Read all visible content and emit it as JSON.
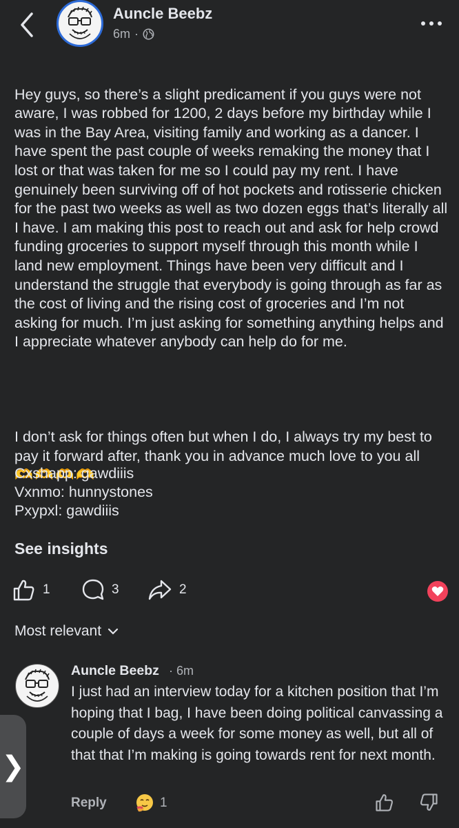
{
  "header": {
    "author": "Auncle Beebz",
    "time": "6m",
    "separator": "·",
    "privacy_icon": "globe-icon",
    "more_icon": "more-horizontal-icon",
    "back_icon": "chevron-left-icon"
  },
  "post": {
    "paragraph1": "Hey guys, so there’s a slight predicament if you guys were not aware, I was robbed for 1200, 2 days before my birthday while I was in the Bay Area, visiting family and working as a dancer. I have spent the past couple of weeks remaking the money that I lost or that was taken for me so I could pay my rent. I have genuinely been surviving off of hot pockets and rotisserie chicken for the past two weeks as well as two dozen eggs that’s literally all I have. I am making this post to reach out and ask for help crowd funding groceries to support myself through this month while I land new employment. Things have been very difficult and I understand the struggle that everybody is going through as far as the cost of living and the rising cost of groceries and I’m not asking for much. I’m just asking for something anything helps and I appreciate whatever anybody can help do for me.",
    "paragraph2": "I don’t ask for things often but when I do, I always try my best to pay it forward after, thank you in advance much love to you all",
    "emoji": "🫶🫶🫶🫶",
    "payments": [
      "Cxshapp: gawdiiis",
      "Vxnmo: hunnystones",
      "Pxypxl: gawdiiis"
    ]
  },
  "see_insights": "See insights",
  "actions": {
    "likes": "1",
    "comments": "3",
    "shares": "2",
    "reaction_badge_color": "#f2425b"
  },
  "sort": {
    "label": "Most relevant"
  },
  "comment": {
    "author": "Auncle Beebz",
    "time": "· 6m",
    "text": "I just had an interview today for a kitchen position that I’m hoping that I bag, I have been doing political canvassing a couple of days a week for some money as well, but all of that that I’m making is going towards rent for next month.",
    "reply_label": "Reply",
    "reaction_count": "1",
    "reaction_icon": "hug-emoji-icon"
  },
  "side_tab": {
    "glyph": "❯"
  },
  "colors": {
    "background": "#242526",
    "text": "#e4e6eb",
    "secondary": "#b0b3b8",
    "avatar_ring": "#2d6bd8"
  }
}
